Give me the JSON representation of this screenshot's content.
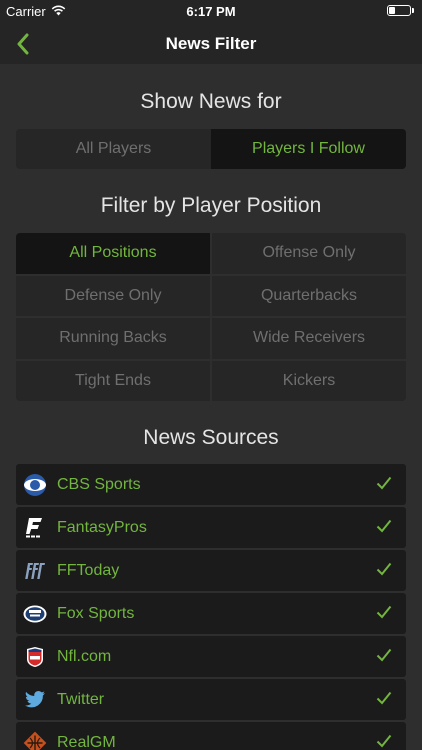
{
  "status_bar": {
    "carrier": "Carrier",
    "time": "6:17 PM"
  },
  "nav": {
    "title": "News Filter",
    "back_icon": "chevron-left-icon"
  },
  "show_news": {
    "heading": "Show News for",
    "options": [
      {
        "label": "All Players",
        "selected": false
      },
      {
        "label": "Players I Follow",
        "selected": true
      }
    ]
  },
  "positions": {
    "heading": "Filter by Player Position",
    "options": [
      {
        "label": "All Positions",
        "selected": true
      },
      {
        "label": "Offense Only",
        "selected": false
      },
      {
        "label": "Defense Only",
        "selected": false
      },
      {
        "label": "Quarterbacks",
        "selected": false
      },
      {
        "label": "Running Backs",
        "selected": false
      },
      {
        "label": "Wide Receivers",
        "selected": false
      },
      {
        "label": "Tight Ends",
        "selected": false
      },
      {
        "label": "Kickers",
        "selected": false
      }
    ]
  },
  "sources": {
    "heading": "News Sources",
    "items": [
      {
        "label": "CBS Sports",
        "icon": "cbs-logo-icon",
        "checked": true
      },
      {
        "label": "FantasyPros",
        "icon": "fantasypros-logo-icon",
        "checked": true
      },
      {
        "label": "FFToday",
        "icon": "fftoday-logo-icon",
        "checked": true
      },
      {
        "label": "Fox Sports",
        "icon": "fox-sports-logo-icon",
        "checked": true
      },
      {
        "label": "Nfl.com",
        "icon": "nfl-logo-icon",
        "checked": true
      },
      {
        "label": "Twitter",
        "icon": "twitter-bird-icon",
        "checked": true
      },
      {
        "label": "RealGM",
        "icon": "realgm-logo-icon",
        "checked": true
      }
    ]
  },
  "colors": {
    "accent": "#72b53f",
    "background": "#2e2e2e",
    "bar": "#252525",
    "selected_bg": "#141414",
    "row_bg": "#1b1b1b"
  }
}
